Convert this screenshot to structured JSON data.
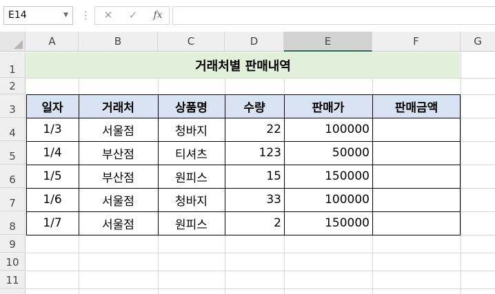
{
  "formula_bar": {
    "name_box": "E14",
    "dots": "⋮",
    "cancel_glyph": "✕",
    "enter_glyph": "✓",
    "fx_glyph": "fx",
    "formula": ""
  },
  "columns": [
    "A",
    "B",
    "C",
    "D",
    "E",
    "F",
    "G"
  ],
  "rows": [
    "1",
    "2",
    "3",
    "4",
    "5",
    "6",
    "7",
    "8",
    "9",
    "10",
    "11"
  ],
  "sheet": {
    "title": "거래처별 판매내역",
    "headers": [
      "일자",
      "거래처",
      "상품명",
      "수량",
      "판매가",
      "판매금액"
    ],
    "data": [
      [
        "1/3",
        "서울점",
        "청바지",
        "22",
        "100000",
        ""
      ],
      [
        "1/4",
        "부산점",
        "티셔츠",
        "123",
        "50000",
        ""
      ],
      [
        "1/5",
        "부산점",
        "원피스",
        "15",
        "150000",
        ""
      ],
      [
        "1/6",
        "서울점",
        "청바지",
        "33",
        "100000",
        ""
      ],
      [
        "1/7",
        "서울점",
        "원피스",
        "2",
        "150000",
        ""
      ]
    ]
  },
  "colors": {
    "title_fill": "#e2efda",
    "header_fill": "#dae3f3",
    "selection_accent": "#217346"
  }
}
